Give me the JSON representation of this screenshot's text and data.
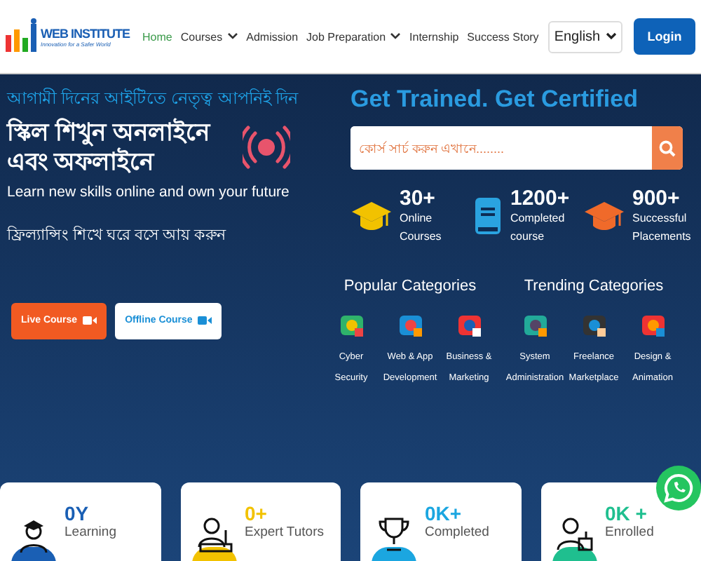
{
  "header": {
    "logo": {
      "name": "WEB INSTITUTE",
      "tagline": "Innovation for a Safer World"
    },
    "nav": [
      {
        "label": "Home",
        "selected": true,
        "dropdown": false
      },
      {
        "label": "Courses",
        "selected": false,
        "dropdown": true
      },
      {
        "label": "Admission",
        "selected": false,
        "dropdown": false
      },
      {
        "label": "Job Preparation",
        "selected": false,
        "dropdown": true
      },
      {
        "label": "Internship",
        "selected": false,
        "dropdown": false
      },
      {
        "label": "Success Story",
        "selected": false,
        "dropdown": false
      }
    ],
    "language": "English",
    "login": "Login"
  },
  "hero": {
    "tagline": "আগামী দিনের আইটিতে নেতৃত্ব আপনিই দিন",
    "headline": "স্কিল শিখুন অনলাইনে এবং অফলাইনে",
    "subtitle": "Learn new skills online and own your future",
    "note": "ফ্রিল্যান্সিং শিখে ঘরে বসে আয় করুন",
    "buttons": [
      {
        "label": "Live Course",
        "kind": "primary"
      },
      {
        "label": "Offline Course",
        "kind": "secondary"
      }
    ],
    "title": "Get Trained. Get Certified",
    "search": {
      "placeholder": "কোর্স সার্চ করুন এখানে........"
    },
    "stats": [
      {
        "value": "30+",
        "label": "Online Courses",
        "kind": "cap"
      },
      {
        "value": "1200+",
        "label": "Completed course",
        "kind": "book"
      },
      {
        "value": "900+",
        "label": "Successful Placements",
        "kind": "cap"
      }
    ]
  },
  "categories": [
    {
      "heading": "Popular Categories",
      "items": [
        {
          "label": "Cyber Security"
        },
        {
          "label": "Web & App Development"
        },
        {
          "label": "Business & Marketing"
        }
      ]
    },
    {
      "heading": "Trending Categories",
      "items": [
        {
          "label": "System Administration"
        },
        {
          "label": "Freelance Marketplace"
        },
        {
          "label": "Design & Animation"
        }
      ]
    }
  ],
  "cards": [
    {
      "value": "0Y",
      "label": "Learning",
      "color": "#1a5fb4",
      "kind": "student"
    },
    {
      "value": "0+",
      "label": "Expert Tutors",
      "color": "#f2c200",
      "kind": "tutor"
    },
    {
      "value": "0K+",
      "label": "Completed",
      "color": "#1ba6e0",
      "kind": "trophy"
    },
    {
      "value": "0K +",
      "label": "Enrolled",
      "color": "#1fbf8f",
      "kind": "enrolled"
    }
  ]
}
